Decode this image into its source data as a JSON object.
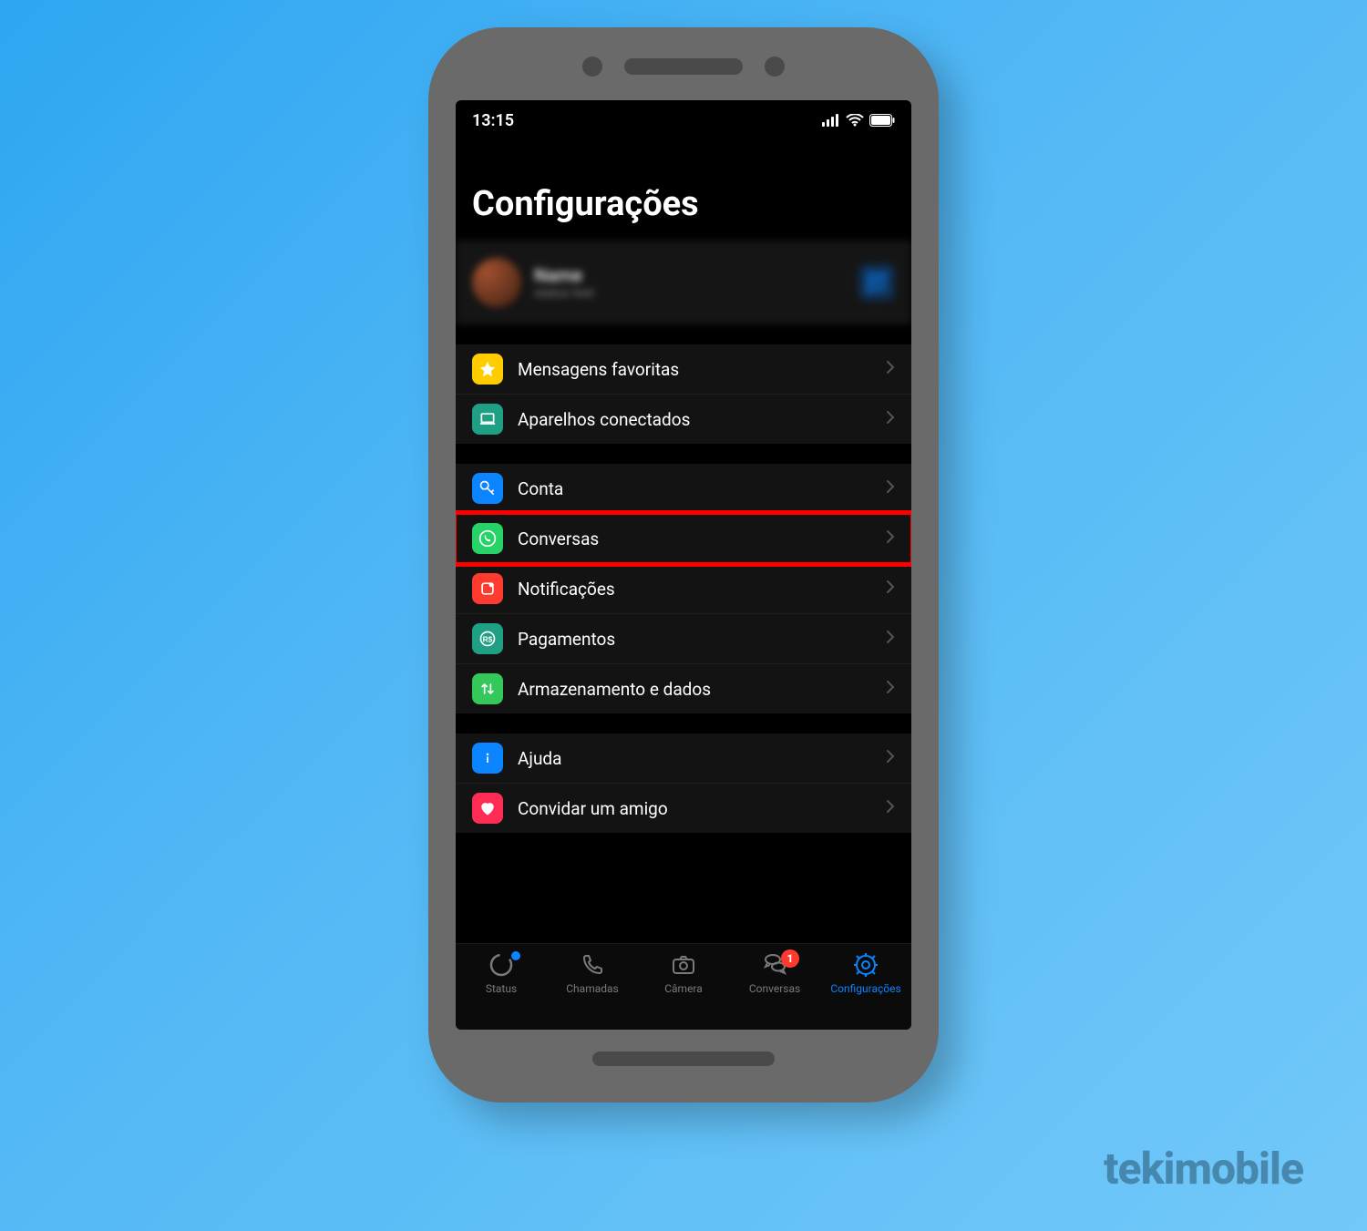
{
  "watermark": "tekimobile",
  "status_bar": {
    "time": "13:15"
  },
  "header": {
    "title": "Configurações"
  },
  "profile": {
    "name_blur": "—",
    "status_blur": "—"
  },
  "groups": [
    {
      "rows": [
        {
          "id": "starred",
          "label": "Mensagens favoritas",
          "icon": "star-icon",
          "icon_bg": "#ffcc00",
          "icon_fg": "#ffffff"
        },
        {
          "id": "linked",
          "label": "Aparelhos conectados",
          "icon": "laptop-icon",
          "icon_bg": "#1fa085",
          "icon_fg": "#ffffff"
        }
      ]
    },
    {
      "rows": [
        {
          "id": "account",
          "label": "Conta",
          "icon": "key-icon",
          "icon_bg": "#0a84ff",
          "icon_fg": "#ffffff"
        },
        {
          "id": "chats",
          "label": "Conversas",
          "icon": "whatsapp-icon",
          "icon_bg": "#25d366",
          "icon_fg": "#ffffff",
          "highlight": true
        },
        {
          "id": "notif",
          "label": "Notificações",
          "icon": "bell-icon",
          "icon_bg": "#ff3b30",
          "icon_fg": "#ffffff"
        },
        {
          "id": "payments",
          "label": "Pagamentos",
          "icon": "money-icon",
          "icon_bg": "#1fa085",
          "icon_fg": "#ffffff"
        },
        {
          "id": "storage",
          "label": "Armazenamento e dados",
          "icon": "updown-icon",
          "icon_bg": "#34c759",
          "icon_fg": "#ffffff"
        }
      ]
    },
    {
      "rows": [
        {
          "id": "help",
          "label": "Ajuda",
          "icon": "info-icon",
          "icon_bg": "#0a84ff",
          "icon_fg": "#ffffff"
        },
        {
          "id": "invite",
          "label": "Convidar um amigo",
          "icon": "heart-icon",
          "icon_bg": "#ff2d55",
          "icon_fg": "#ffffff"
        }
      ]
    }
  ],
  "tabs": [
    {
      "id": "status",
      "label": "Status",
      "icon": "circle-dot-icon",
      "dot": true
    },
    {
      "id": "calls",
      "label": "Chamadas",
      "icon": "phone-icon"
    },
    {
      "id": "camera",
      "label": "Câmera",
      "icon": "camera-icon"
    },
    {
      "id": "chats",
      "label": "Conversas",
      "icon": "chat-icon",
      "badge": "1"
    },
    {
      "id": "settings",
      "label": "Configurações",
      "icon": "gear-icon",
      "active": true
    }
  ]
}
